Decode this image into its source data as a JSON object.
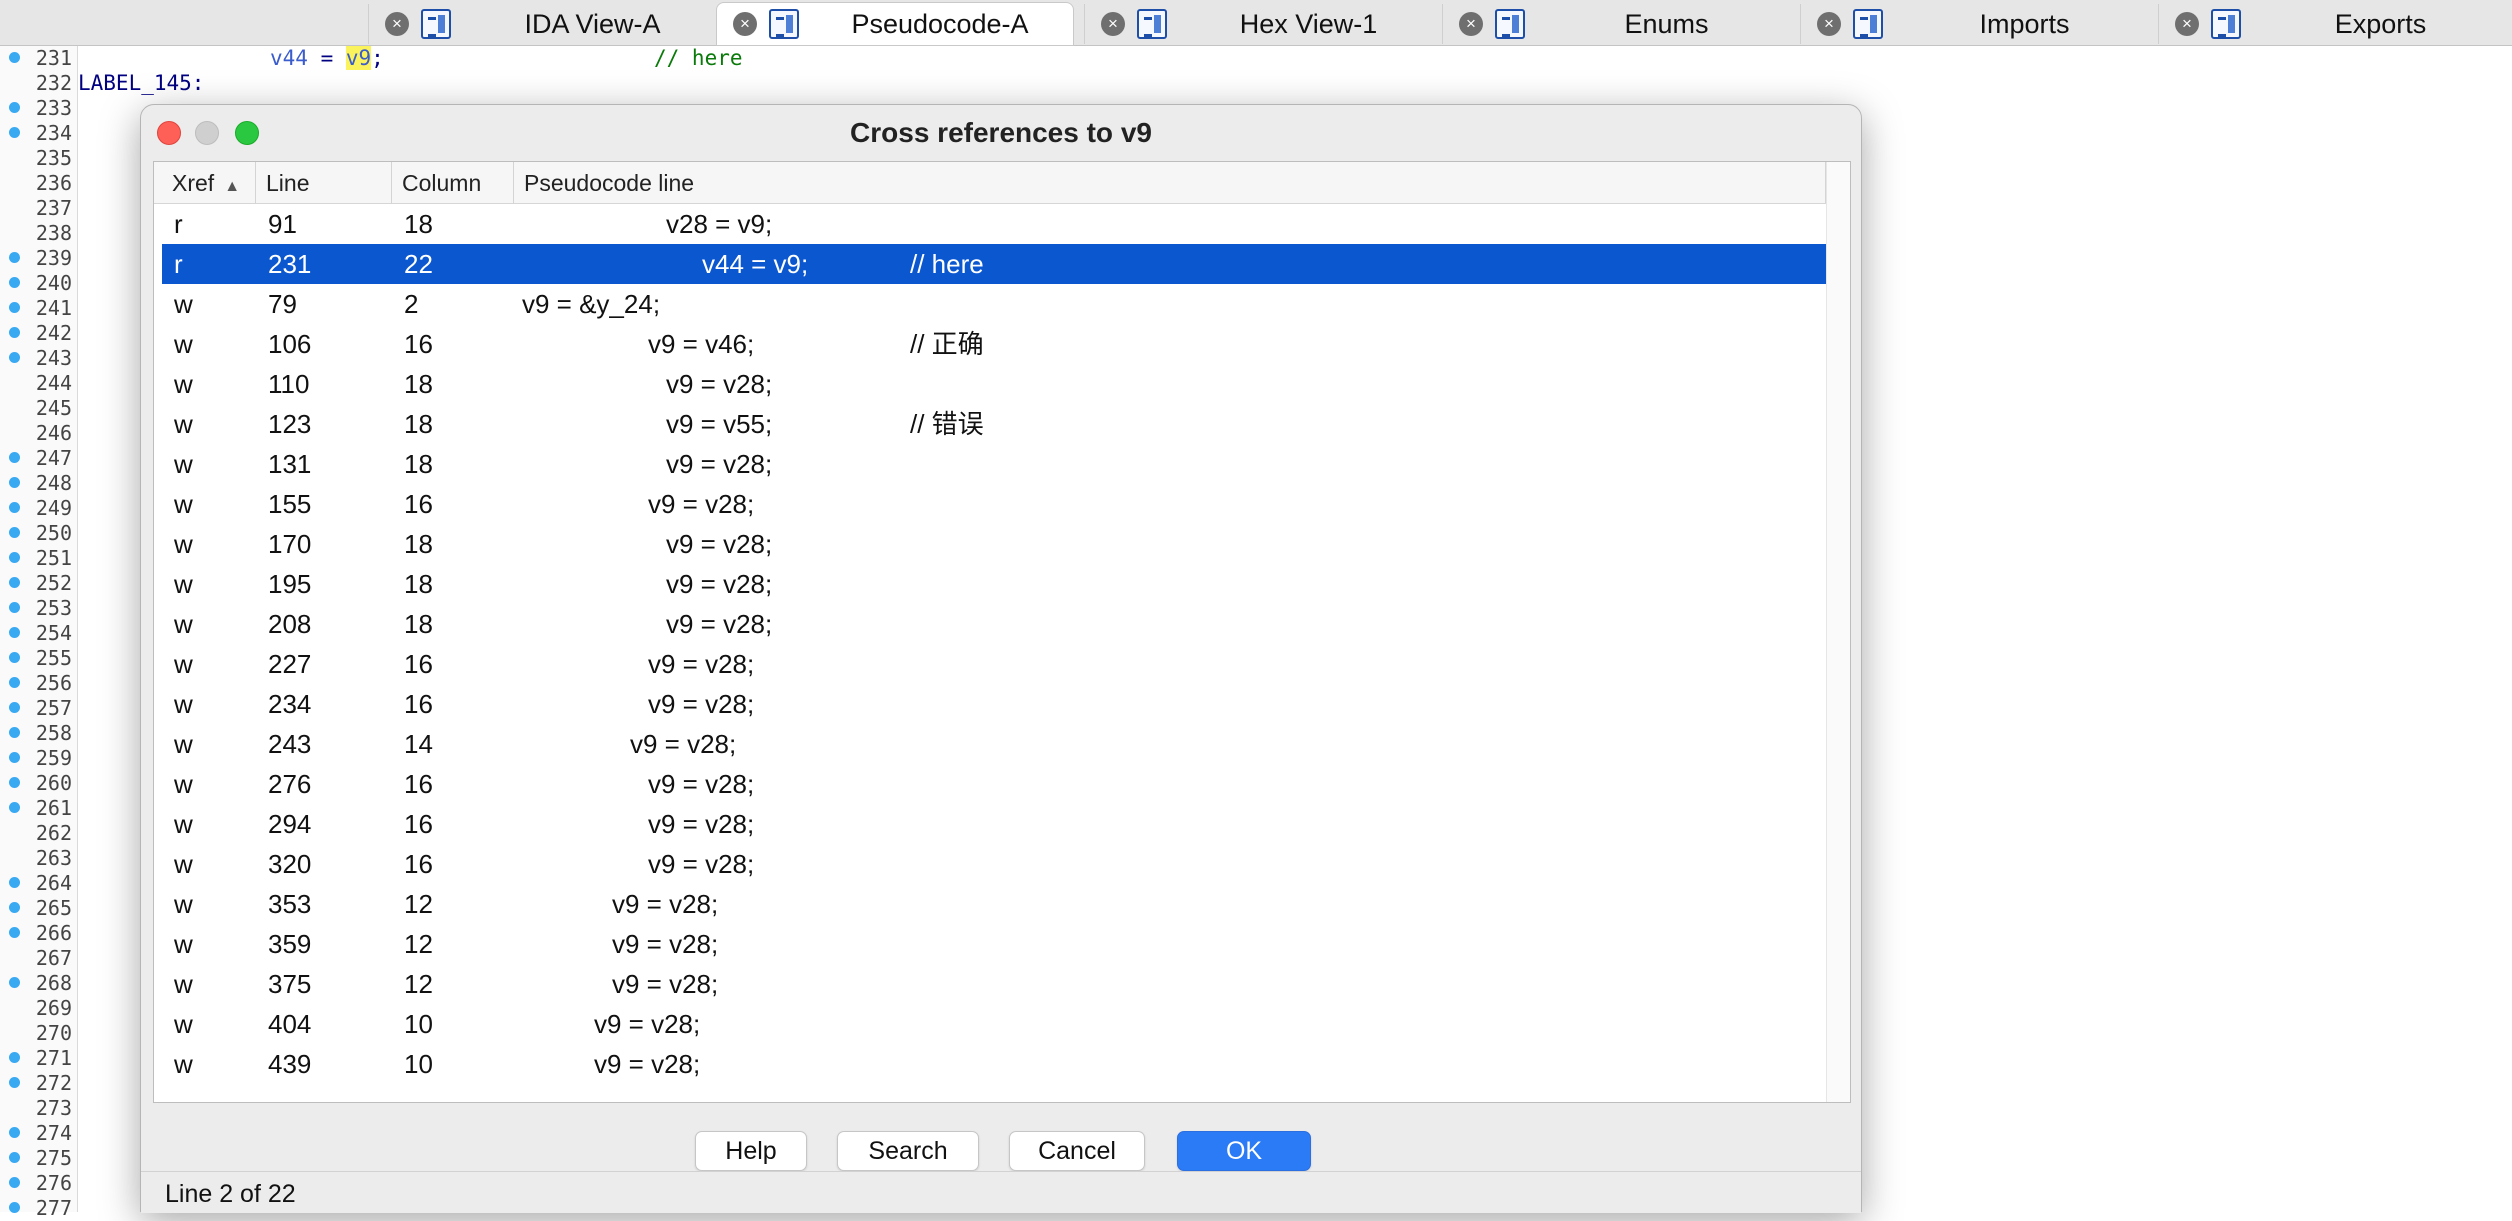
{
  "tabs": [
    {
      "label": "IDA View-A",
      "icon": "ida-view-icon",
      "active": false
    },
    {
      "label": "Pseudocode-A",
      "icon": "pseudocode-icon",
      "active": true
    },
    {
      "label": "Hex View-1",
      "icon": "hex-view-icon",
      "active": false
    },
    {
      "label": "Enums",
      "icon": "enums-icon",
      "active": false
    },
    {
      "label": "Imports",
      "icon": "imports-icon",
      "active": false
    },
    {
      "label": "Exports",
      "icon": "exports-icon",
      "active": false
    }
  ],
  "code": {
    "line_231": {
      "var": "v44",
      "eq": " = ",
      "hl": "v9",
      "rest": ";",
      "comment": "// here"
    },
    "line_232_label": "LABEL_145:",
    "gutter": [
      {
        "n": "231",
        "dot": true
      },
      {
        "n": "232",
        "dot": false
      },
      {
        "n": "233",
        "dot": true
      },
      {
        "n": "234",
        "dot": true
      },
      {
        "n": "235",
        "dot": false
      },
      {
        "n": "236",
        "dot": false
      },
      {
        "n": "237",
        "dot": false
      },
      {
        "n": "238",
        "dot": false
      },
      {
        "n": "239",
        "dot": true
      },
      {
        "n": "240",
        "dot": true
      },
      {
        "n": "241",
        "dot": true
      },
      {
        "n": "242",
        "dot": true
      },
      {
        "n": "243",
        "dot": true
      },
      {
        "n": "244",
        "dot": false
      },
      {
        "n": "245",
        "dot": false
      },
      {
        "n": "246",
        "dot": false
      },
      {
        "n": "247",
        "dot": true
      },
      {
        "n": "248",
        "dot": true
      },
      {
        "n": "249",
        "dot": true
      },
      {
        "n": "250",
        "dot": true
      },
      {
        "n": "251",
        "dot": true
      },
      {
        "n": "252",
        "dot": true
      },
      {
        "n": "253",
        "dot": true
      },
      {
        "n": "254",
        "dot": true
      },
      {
        "n": "255",
        "dot": true
      },
      {
        "n": "256",
        "dot": true
      },
      {
        "n": "257",
        "dot": true
      },
      {
        "n": "258",
        "dot": true
      },
      {
        "n": "259",
        "dot": true
      },
      {
        "n": "260",
        "dot": true
      },
      {
        "n": "261",
        "dot": true
      },
      {
        "n": "262",
        "dot": false
      },
      {
        "n": "263",
        "dot": false
      },
      {
        "n": "264",
        "dot": true
      },
      {
        "n": "265",
        "dot": true
      },
      {
        "n": "266",
        "dot": true
      },
      {
        "n": "267",
        "dot": false
      },
      {
        "n": "268",
        "dot": true
      },
      {
        "n": "269",
        "dot": false
      },
      {
        "n": "270",
        "dot": false
      },
      {
        "n": "271",
        "dot": true
      },
      {
        "n": "272",
        "dot": true
      },
      {
        "n": "273",
        "dot": false
      },
      {
        "n": "274",
        "dot": true
      },
      {
        "n": "275",
        "dot": true
      },
      {
        "n": "276",
        "dot": true
      },
      {
        "n": "277",
        "dot": true
      }
    ]
  },
  "dialog": {
    "title": "Cross references to v9",
    "columns": {
      "xref": "Xref",
      "line": "Line",
      "column": "Column",
      "pseudocode": "Pseudocode line"
    },
    "sort_icon": "sort-ascending-icon",
    "rows": [
      {
        "xref": "r",
        "line": "91",
        "column": "18",
        "code": "v28 = v9;",
        "comment": ""
      },
      {
        "xref": "r",
        "line": "231",
        "column": "22",
        "code": "v44 = v9;",
        "comment": "// here"
      },
      {
        "xref": "w",
        "line": "79",
        "column": "2",
        "code": "v9 = &y_24;",
        "comment": ""
      },
      {
        "xref": "w",
        "line": "106",
        "column": "16",
        "code": "v9 = v46;",
        "comment": "// 正确"
      },
      {
        "xref": "w",
        "line": "110",
        "column": "18",
        "code": "v9 = v28;",
        "comment": ""
      },
      {
        "xref": "w",
        "line": "123",
        "column": "18",
        "code": "v9 = v55;",
        "comment": "// 错误"
      },
      {
        "xref": "w",
        "line": "131",
        "column": "18",
        "code": "v9 = v28;",
        "comment": ""
      },
      {
        "xref": "w",
        "line": "155",
        "column": "16",
        "code": "v9 = v28;",
        "comment": ""
      },
      {
        "xref": "w",
        "line": "170",
        "column": "18",
        "code": "v9 = v28;",
        "comment": ""
      },
      {
        "xref": "w",
        "line": "195",
        "column": "18",
        "code": "v9 = v28;",
        "comment": ""
      },
      {
        "xref": "w",
        "line": "208",
        "column": "18",
        "code": "v9 = v28;",
        "comment": ""
      },
      {
        "xref": "w",
        "line": "227",
        "column": "16",
        "code": "v9 = v28;",
        "comment": ""
      },
      {
        "xref": "w",
        "line": "234",
        "column": "16",
        "code": "v9 = v28;",
        "comment": ""
      },
      {
        "xref": "w",
        "line": "243",
        "column": "14",
        "code": "v9 = v28;",
        "comment": ""
      },
      {
        "xref": "w",
        "line": "276",
        "column": "16",
        "code": "v9 = v28;",
        "comment": ""
      },
      {
        "xref": "w",
        "line": "294",
        "column": "16",
        "code": "v9 = v28;",
        "comment": ""
      },
      {
        "xref": "w",
        "line": "320",
        "column": "16",
        "code": "v9 = v28;",
        "comment": ""
      },
      {
        "xref": "w",
        "line": "353",
        "column": "12",
        "code": "v9 = v28;",
        "comment": ""
      },
      {
        "xref": "w",
        "line": "359",
        "column": "12",
        "code": "v9 = v28;",
        "comment": ""
      },
      {
        "xref": "w",
        "line": "375",
        "column": "12",
        "code": "v9 = v28;",
        "comment": ""
      },
      {
        "xref": "w",
        "line": "404",
        "column": "10",
        "code": "v9 = v28;",
        "comment": ""
      },
      {
        "xref": "w",
        "line": "439",
        "column": "10",
        "code": "v9 = v28;",
        "comment": ""
      }
    ],
    "selected_index": 1,
    "buttons": {
      "help": "Help",
      "search": "Search",
      "cancel": "Cancel",
      "ok": "OK"
    },
    "status": "Line 2 of 22"
  },
  "colors": {
    "selection": "#0b57d0",
    "ok_button": "#2b7bf6",
    "gutter_dot": "#39a9f2",
    "highlight": "#fbf35c"
  }
}
